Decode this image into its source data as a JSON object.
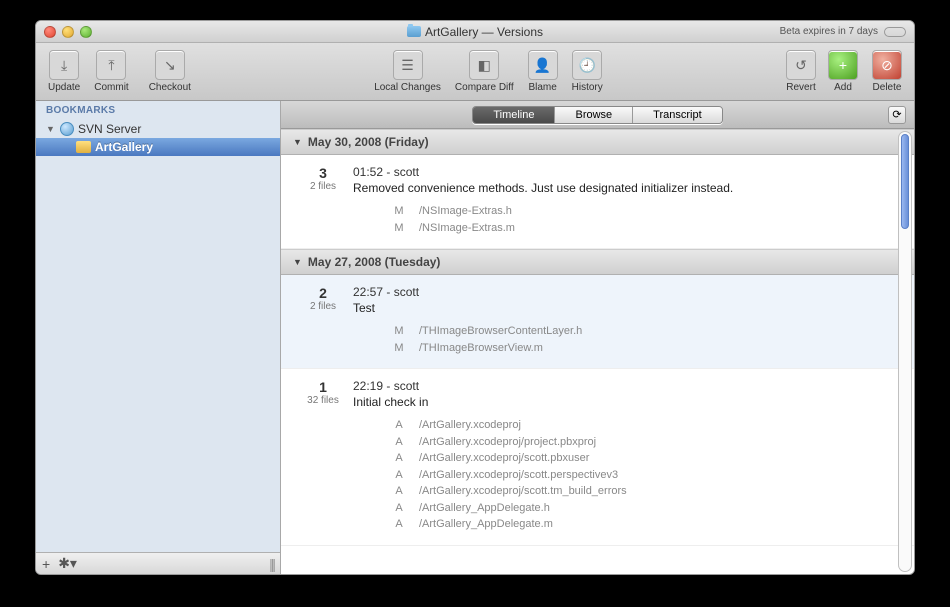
{
  "window": {
    "title": "ArtGallery — Versions",
    "beta_text": "Beta expires in 7 days"
  },
  "toolbar": {
    "update": "Update",
    "commit": "Commit",
    "checkout": "Checkout",
    "local_changes": "Local Changes",
    "compare_diff": "Compare Diff",
    "blame": "Blame",
    "history": "History",
    "revert": "Revert",
    "add": "Add",
    "delete": "Delete"
  },
  "sidebar": {
    "header": "BOOKMARKS",
    "server": "SVN Server",
    "repo": "ArtGallery"
  },
  "tabs": {
    "timeline": "Timeline",
    "browse": "Browse",
    "transcript": "Transcript"
  },
  "dates": {
    "d1": "May 30, 2008 (Friday)",
    "d2": "May 27, 2008 (Tuesday)"
  },
  "commits": [
    {
      "rev": "3",
      "count": "2 files",
      "meta": "01:52 - scott",
      "msg": "Removed convenience methods. Just use designated initializer instead.",
      "files": [
        {
          "mark": "M",
          "path": "/NSImage-Extras.h"
        },
        {
          "mark": "M",
          "path": "/NSImage-Extras.m"
        }
      ]
    },
    {
      "rev": "2",
      "count": "2 files",
      "meta": "22:57 - scott",
      "msg": "Test",
      "files": [
        {
          "mark": "M",
          "path": "/THImageBrowserContentLayer.h"
        },
        {
          "mark": "M",
          "path": "/THImageBrowserView.m"
        }
      ]
    },
    {
      "rev": "1",
      "count": "32 files",
      "meta": "22:19 - scott",
      "msg": "Initial check in",
      "files": [
        {
          "mark": "A",
          "path": "/ArtGallery.xcodeproj"
        },
        {
          "mark": "A",
          "path": "/ArtGallery.xcodeproj/project.pbxproj"
        },
        {
          "mark": "A",
          "path": "/ArtGallery.xcodeproj/scott.pbxuser"
        },
        {
          "mark": "A",
          "path": "/ArtGallery.xcodeproj/scott.perspectivev3"
        },
        {
          "mark": "A",
          "path": "/ArtGallery.xcodeproj/scott.tm_build_errors"
        },
        {
          "mark": "A",
          "path": "/ArtGallery_AppDelegate.h"
        },
        {
          "mark": "A",
          "path": "/ArtGallery_AppDelegate.m"
        }
      ]
    }
  ]
}
